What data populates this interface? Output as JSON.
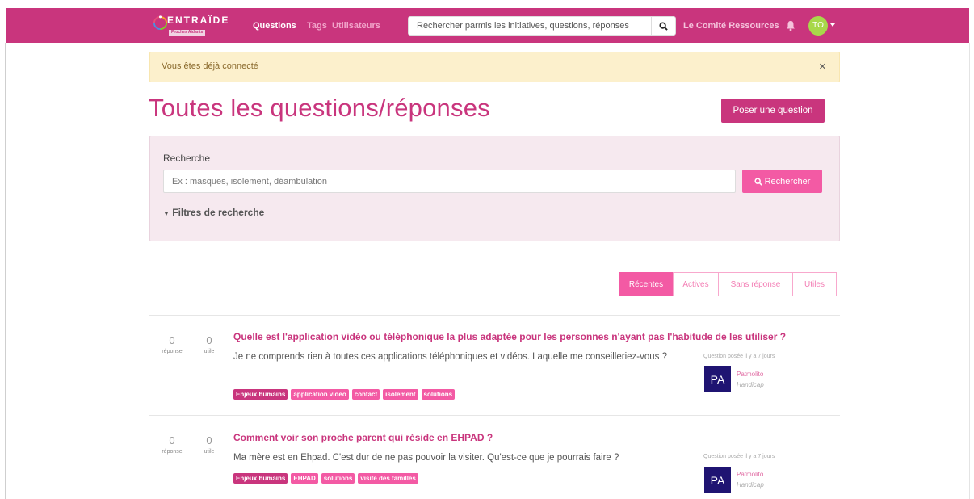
{
  "navbar": {
    "logo_text": "ENTRAÏDE",
    "logo_sub": "Proches Aidants",
    "links": [
      "Questions",
      "Tags",
      "Utilisateurs"
    ],
    "search_placeholder": "Rechercher parmis les initiatives, questions, réponses",
    "committee": "Le Comité Ressources",
    "avatar_initials": "TO",
    "bg_color": "#c9357d"
  },
  "alert": {
    "message": "Vous êtes déjà connecté",
    "close": "×"
  },
  "page_title": "Toutes les questions/réponses",
  "ask_button": "Poser une question",
  "search": {
    "label": "Recherche",
    "placeholder": "Ex : masques, isolement, déambulation",
    "button": "Rechercher",
    "filters": "Filtres de recherche"
  },
  "sort_tabs": [
    {
      "label": "Récentes",
      "active": true
    },
    {
      "label": "Actives",
      "active": false
    },
    {
      "label": "Sans réponse",
      "active": false
    },
    {
      "label": "Utiles",
      "active": false
    }
  ],
  "questions": [
    {
      "answers": "0",
      "answers_label": "réponse",
      "useful": "0",
      "useful_label": "utile",
      "title": "Quelle est l'application vidéo ou téléphonique la plus adaptée pour les personnes n'ayant pas l'habitude de les utiliser ?",
      "excerpt": "Je ne comprends rien à toutes ces applications téléphoniques et vidéos. Laquelle me conseilleriez-vous ?",
      "tags": [
        "Enjeux humains",
        "application video",
        "contact",
        "isolement",
        "solutions"
      ],
      "asked": "Question posée il y a 7 jours",
      "user_initials": "PA",
      "user_name": "Patmolito",
      "user_role": "Handicap"
    },
    {
      "answers": "0",
      "answers_label": "réponse",
      "useful": "0",
      "useful_label": "utile",
      "title": "Comment voir son proche parent qui réside en EHPAD ?",
      "excerpt": "Ma mère est en Ehpad. C'est dur de ne pas pouvoir la visiter. Qu'est-ce que je pourrais faire ?",
      "tags": [
        "Enjeux humains",
        "EHPAD",
        "solutions",
        "visite des familles"
      ],
      "asked": "Question posée il y a 7 jours",
      "user_initials": "PA",
      "user_name": "Patmolito",
      "user_role": "Handicap"
    }
  ]
}
